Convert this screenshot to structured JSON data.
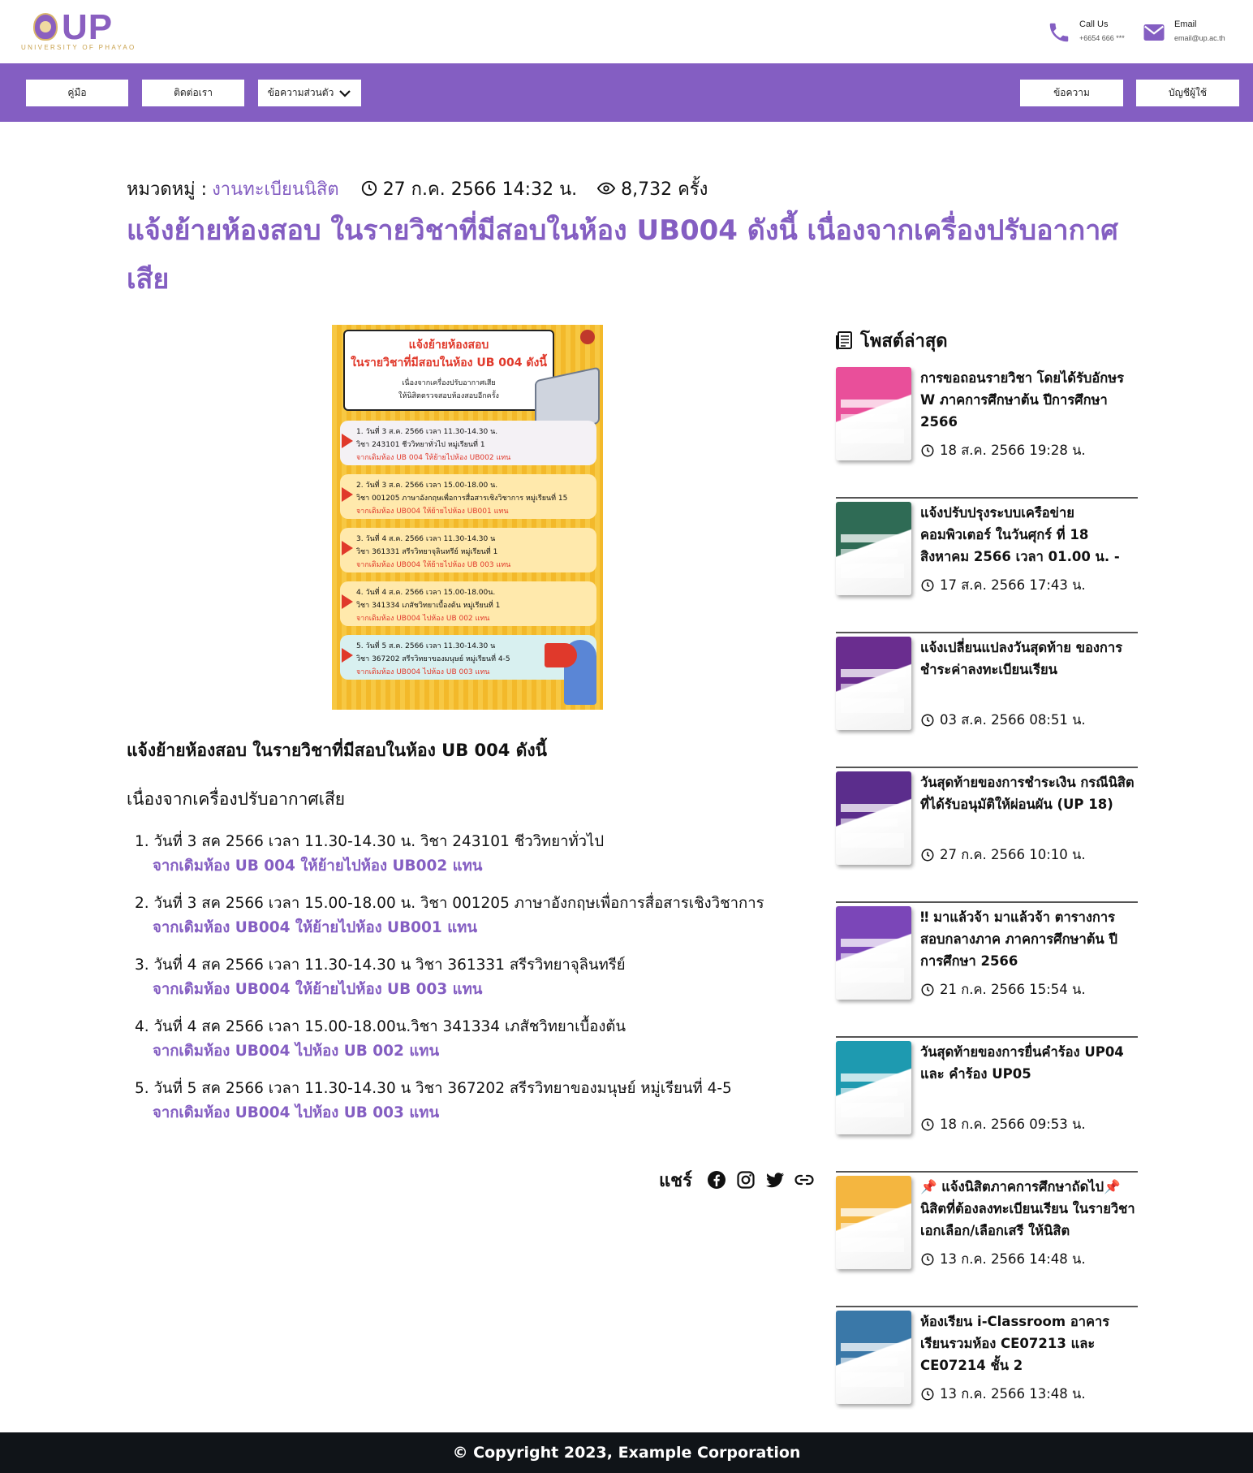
{
  "header": {
    "logo_text": "UP",
    "logo_sub": "UNIVERSITY OF PHAYAO",
    "call_label": "Call Us",
    "call_value": "+6654 666 ***",
    "email_label": "Email",
    "email_value": "email@up.ac.th"
  },
  "nav": {
    "manual": "คู่มือ",
    "contact": "ติดต่อเรา",
    "personal_messages": "ข้อความส่วนตัว",
    "messages": "ข้อความ",
    "account": "บัญชีผู้ใช้"
  },
  "article": {
    "category_label": "หมวดหมู่ :",
    "category": "งานทะเบียนนิสิต",
    "datetime": "27 ก.ค. 2566 14:32 น.",
    "views": "8,732 ครั้ง",
    "title": "แจ้งย้ายห้องสอบ ในรายวิชาที่มีสอบในห้อง UB004 ดังนี้ เนื่องจากเครื่องปรับอากาศเสีย",
    "subheading": "แจ้งย้ายห้องสอบ ในรายวิชาที่มีสอบในห้อง UB 004 ดังนี้",
    "reason": "เนื่องจากเครื่องปรับอากาศเสีย",
    "items": [
      {
        "line": "1. วันที่ 3 สค 2566 เวลา 11.30-14.30 น. วิชา 243101 ชีววิทยาทั่วไป",
        "note": "จากเดิมห้อง UB 004 ให้ย้ายไปห้อง UB002 แทน"
      },
      {
        "line": "2. วันที่ 3 สค 2566 เวลา 15.00-18.00 น. วิชา 001205 ภาษาอังกฤษเพื่อการสื่อสารเชิงวิชาการ",
        "note": "จากเดิมห้อง UB004 ให้ย้ายไปห้อง UB001 แทน"
      },
      {
        "line": "3. วันที่ 4 สค 2566 เวลา 11.30-14.30 น วิชา 361331 สรีรวิทยาจุลินทรีย์",
        "note": "จากเดิมห้อง UB004 ให้ย้ายไปห้อง UB 003 แทน"
      },
      {
        "line": "4. วันที่ 4 สค 2566 เวลา 15.00-18.00น.วิชา 341334 เภสัชวิทยาเบื้องต้น",
        "note": "จากเดิมห้อง UB004 ไปห้อง UB 002 แทน"
      },
      {
        "line": "5. วันที่ 5 สค 2566 เวลา 11.30-14.30 น วิชา 367202 สรีรวิทยาของมนุษย์ หมู่เรียนที่ 4-5",
        "note": "จากเดิมห้อง UB004 ไปห้อง UB 003 แทน"
      }
    ],
    "share_label": "แชร์"
  },
  "poster": {
    "heading1": "แจ้งย้ายห้องสอบ",
    "heading2": "ในรายวิชาที่มีสอบในห้อง UB 004 ดังนี้",
    "heading3": "เนื่องจากเครื่องปรับอากาศเสีย",
    "heading4": "ให้นิสิตตรวจสอบห้องสอบอีกครั้ง",
    "cards": [
      {
        "a": "1. วันที่ 3 ส.ค. 2566 เวลา 11.30-14.30 น.",
        "b": "วิชา 243101 ชีววิทยาทั่วไป หมู่เรียนที่ 1",
        "c": "จากเดิมห้อง UB 004 ให้ย้ายไปห้อง UB002 แทน"
      },
      {
        "a": "2. วันที่ 3 ส.ค. 2566 เวลา 15.00-18.00 น.",
        "b": "วิชา 001205 ภาษาอังกฤษเพื่อการสื่อสารเชิงวิชาการ หมู่เรียนที่ 15",
        "c": "จากเดิมห้อง UB004 ให้ย้ายไปห้อง UB001 แทน"
      },
      {
        "a": "3. วันที่ 4 ส.ค. 2566 เวลา 11.30-14.30 น",
        "b": "วิชา 361331 สรีรวิทยาจุลินทรีย์ หมู่เรียนที่ 1",
        "c": "จากเดิมห้อง UB004 ให้ย้ายไปห้อง UB 003 แทน"
      },
      {
        "a": "4. วันที่ 4 ส.ค. 2566 เวลา 15.00-18.00น.",
        "b": "วิชา 341334 เภสัชวิทยาเบื้องต้น หมู่เรียนที่ 1",
        "c": "จากเดิมห้อง UB004 ไปห้อง UB 002 แทน"
      },
      {
        "a": "5. วันที่ 5 ส.ค. 2566 เวลา 11.30-14.30 น",
        "b": "วิชา 367202 สรีรวิทยาของมนุษย์ หมู่เรียนที่ 4-5",
        "c": "จากเดิมห้อง UB004 ไปห้อง UB 003 แทน"
      }
    ]
  },
  "sidebar": {
    "title": "โพสต์ล่าสุด",
    "posts": [
      {
        "title": "การขอถอนรายวิชา โดยได้รับอักษร W ภาคการศึกษาต้น ปีการศึกษา 2566",
        "date": "18 ส.ค. 2566 19:28 น.",
        "color": "#e94f9a"
      },
      {
        "title": "แจ้งปรับปรุงระบบเครือข่ายคอมพิวเตอร์ ในวันศุกร์ ที่ 18 สิงหาคม 2566 เวลา 01.00 น. -",
        "date": "17 ส.ค. 2566 17:43 น.",
        "color": "#2f6b55"
      },
      {
        "title": "แจ้งเปลี่ยนแปลงวันสุดท้าย ของการชำระค่าลงทะเบียนเรียน",
        "date": "03 ส.ค. 2566 08:51 น.",
        "color": "#6a2d8f"
      },
      {
        "title": "วันสุดท้ายของการชำระเงิน กรณีนิสิตที่ได้รับอนุมัติให้ผ่อนผัน (UP 18)",
        "date": "27 ก.ค. 2566 10:10 น.",
        "color": "#5b2d8c"
      },
      {
        "title": "‼ มาแล้วจ้า มาแล้วจ้า ตารางการสอบกลางภาค ภาคการศึกษาต้น ปีการศึกษา 2566",
        "date": "21 ก.ค. 2566 15:54 น.",
        "color": "#7b46b8"
      },
      {
        "title": "วันสุดท้ายของการยื่นคำร้อง UP04 และ คำร้อง UP05",
        "date": "18 ก.ค. 2566 09:53 น.",
        "color": "#1e9ab0"
      },
      {
        "title": "📌 แจ้งนิสิตภาคการศึกษาถัดไป📌 นิสิตที่ต้องลงทะเบียนเรียน ในรายวิชาเอกเลือก/เลือกเสรี ให้นิสิต",
        "date": "13 ก.ค. 2566 14:48 น.",
        "color": "#f4b640"
      },
      {
        "title": "ห้องเรียน i-Classroom อาคารเรียนรวมห้อง CE07213 และ CE07214 ชั้น 2",
        "date": "13 ก.ค. 2566 13:48 น.",
        "color": "#3a78a8"
      }
    ]
  },
  "footer": {
    "copyright": "© Copyright 2023, Example Corporation"
  },
  "colors": {
    "brand": "#845ec2",
    "footer": "#101418"
  }
}
